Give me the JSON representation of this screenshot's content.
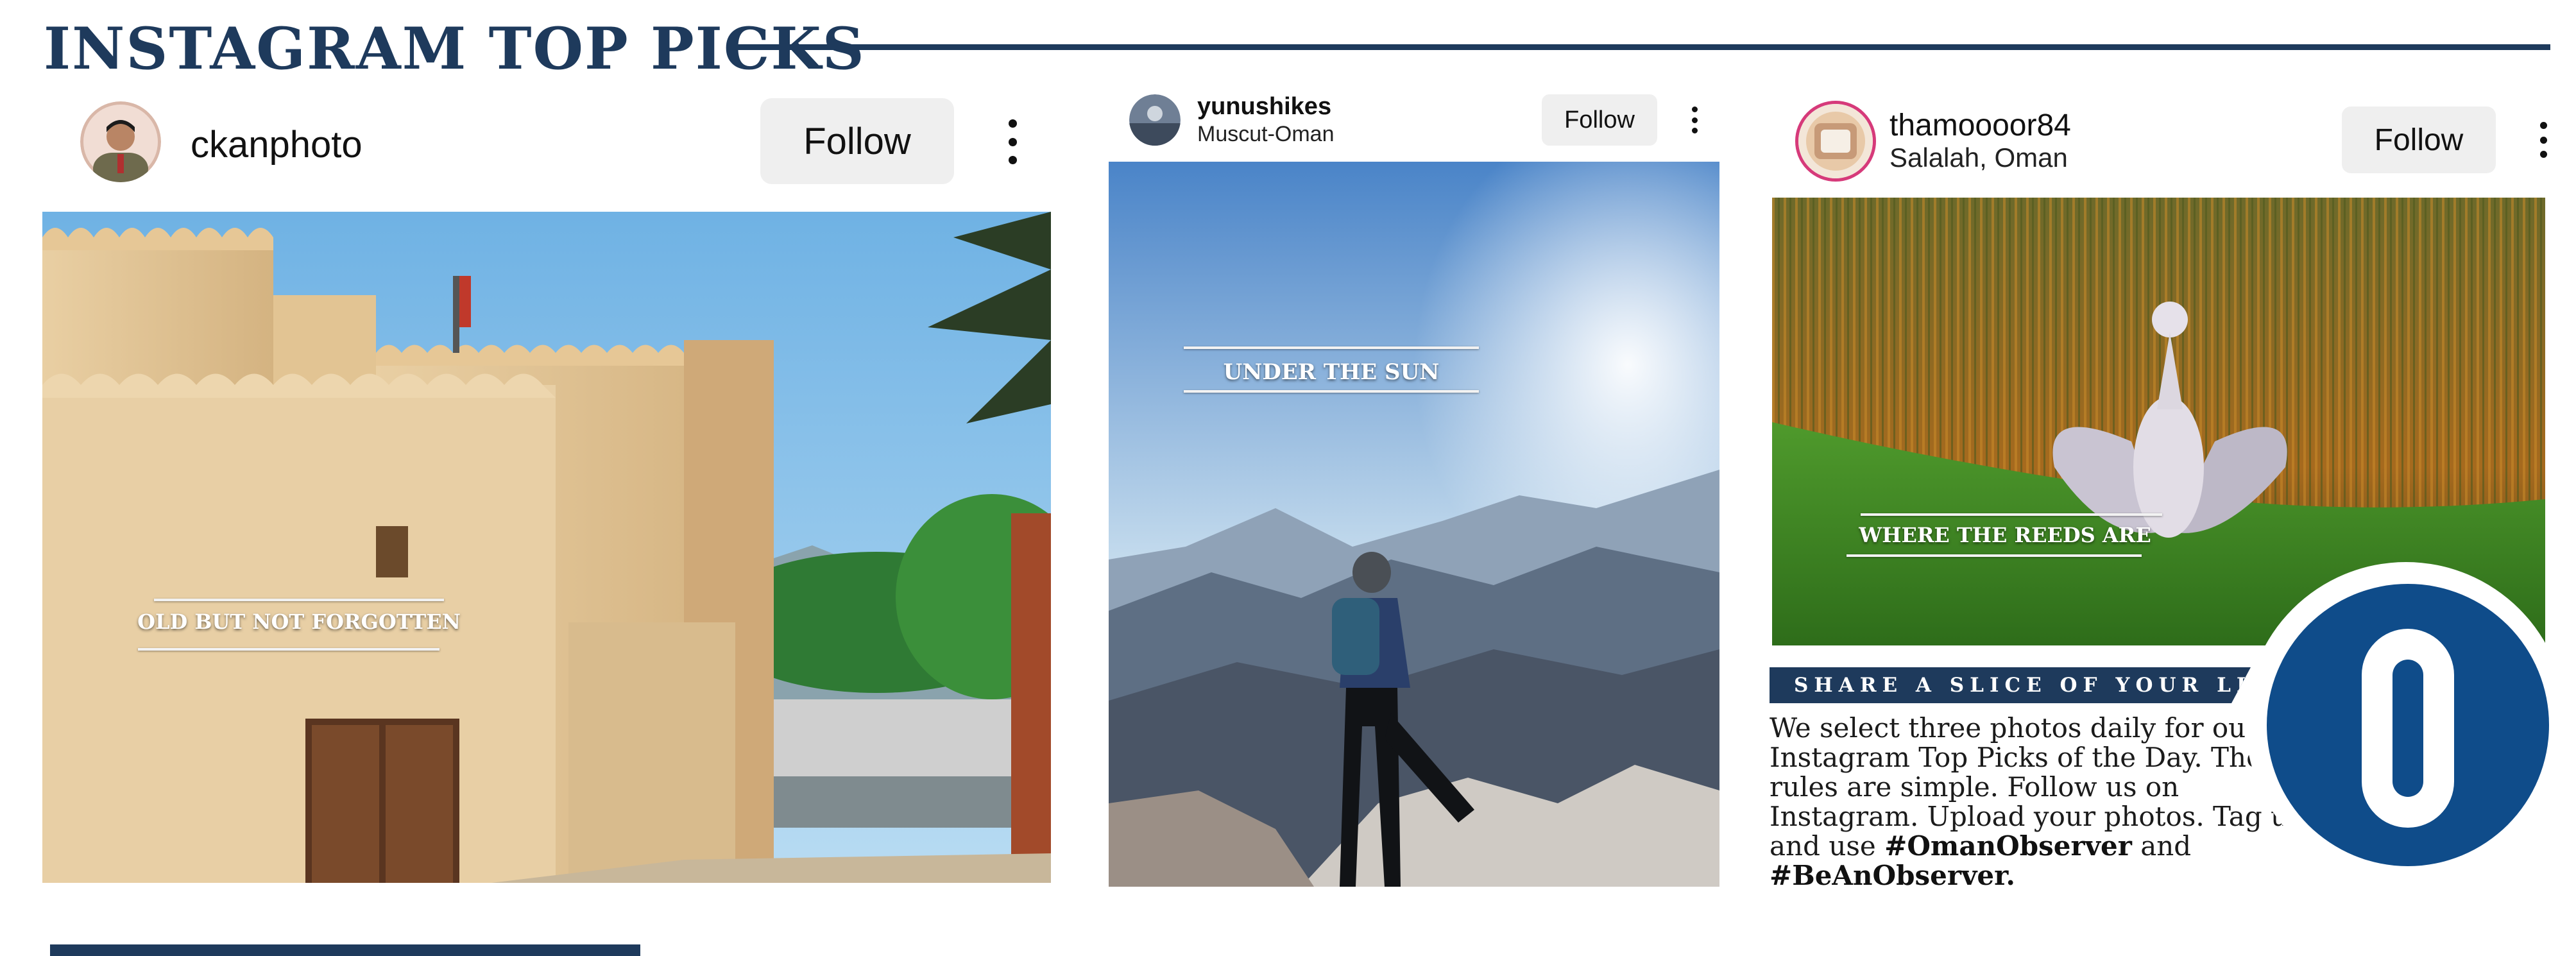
{
  "header": {
    "title": "INSTAGRAM TOP PICKS"
  },
  "posts": [
    {
      "username": "ckanphoto",
      "location": "",
      "follow_label": "Follow",
      "caption": "OLD BUT NOT FORGOTTEN"
    },
    {
      "username": "yunushikes",
      "location": "Muscut-Oman",
      "follow_label": "Follow",
      "caption": "UNDER THE SUN"
    },
    {
      "username": "thamoooor84",
      "location": "Salalah, Oman",
      "follow_label": "Follow",
      "caption": "WHERE THE REEDS ARE"
    }
  ],
  "promo": {
    "banner": "SHARE A SLICE OF YOUR LIFE",
    "body": "We select three photos daily for our Instagram Top Picks of the Day. The rules are simple. Follow us on Instagram. Upload your photos. Tag us and use",
    "hashtag1": "#OmanObserver",
    "connector": "and",
    "hashtag2": "#BeAnObserver."
  },
  "colors": {
    "brand_navy": "#1e3a5c",
    "brand_blue": "#0f4c8a",
    "follow_button_bg": "#efefef"
  },
  "icons": [
    "more-options-icon",
    "observer-logo-icon"
  ]
}
